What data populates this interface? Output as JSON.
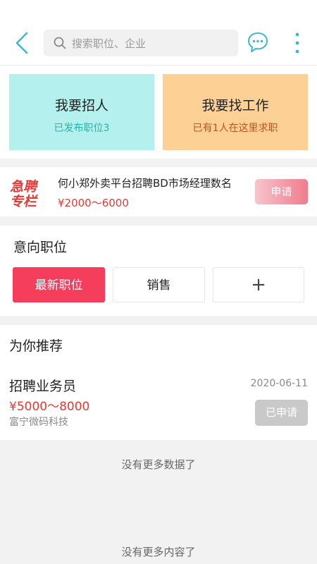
{
  "header": {
    "search_placeholder": "搜索职位、企业",
    "icons": [
      "back-arrow-icon",
      "search-icon",
      "message-icon",
      "more-vertical-icon"
    ],
    "accent_color": "#3bb8cf"
  },
  "cards": {
    "hire": {
      "title": "我要招人",
      "subtitle": "已发布职位3",
      "bg": "#b3f0ee"
    },
    "job": {
      "title": "我要找工作",
      "subtitle": "已有1人在这里求职",
      "bg": "#fdd095"
    }
  },
  "urgent": {
    "logo_text": [
      "急聘",
      "专栏"
    ],
    "title": "何小郑外卖平台招聘BD市场经理数名",
    "salary": "¥2000～6000",
    "apply_label": "申请"
  },
  "intent": {
    "heading": "意向职位",
    "chips": [
      "最新职位",
      "销售",
      "+"
    ],
    "active_color": "#f53d5c"
  },
  "recommend": {
    "heading": "为你推荐",
    "jobs": [
      {
        "title": "招聘业务员",
        "date": "2020-06-11",
        "salary": "¥5000～8000",
        "company": "富宁微码科技",
        "status_label": "已申请"
      }
    ]
  },
  "footer": {
    "no_more_data": "没有更多数据了",
    "no_more_content": "没有更多内容了"
  }
}
